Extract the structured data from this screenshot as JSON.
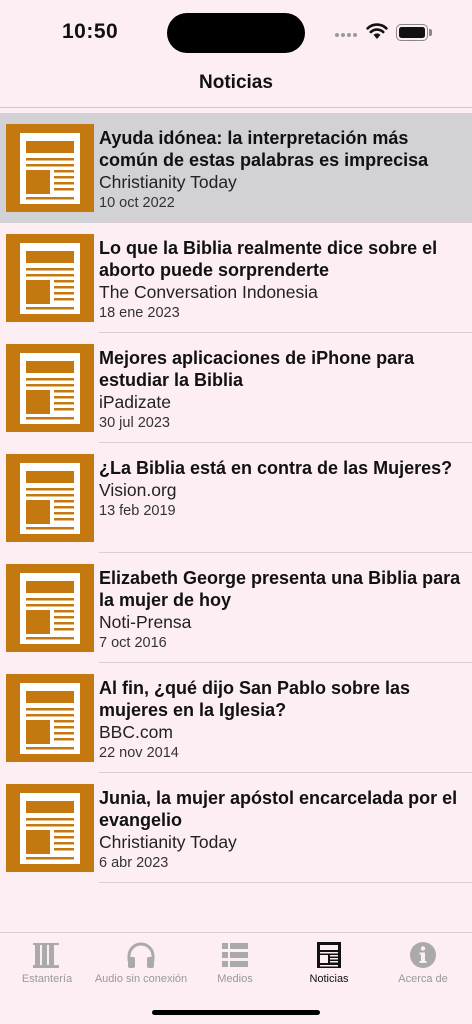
{
  "status_bar": {
    "time": "10:50"
  },
  "nav": {
    "title": "Noticias"
  },
  "news": [
    {
      "headline": "Ayuda idónea: la interpretación más común de estas palabras es imprecisa",
      "source": "Christianity Today",
      "date": "10 oct 2022",
      "selected": true
    },
    {
      "headline": "Lo que la Biblia realmente dice sobre el aborto puede sorprenderte",
      "source": "The Conversation Indonesia",
      "date": "18 ene 2023"
    },
    {
      "headline": "Mejores aplicaciones de iPhone para estudiar la Biblia",
      "source": "iPadizate",
      "date": "30 jul 2023"
    },
    {
      "headline": "¿La Biblia está en contra de las Mujeres?",
      "source": "Vision.org",
      "date": "13 feb 2019"
    },
    {
      "headline": "Elizabeth George presenta una Biblia para la mujer de hoy",
      "source": "Noti-Prensa",
      "date": "7 oct 2016"
    },
    {
      "headline": "Al fin, ¿qué dijo San Pablo sobre las mujeres en la Iglesia?",
      "source": "BBC.com",
      "date": "22 nov 2014"
    },
    {
      "headline": "Junia, la mujer apóstol encarcelada por el evangelio",
      "source": "Christianity Today",
      "date": "6 abr 2023"
    }
  ],
  "tab_bar": {
    "tabs": [
      {
        "label": "Estantería",
        "icon": "books-icon"
      },
      {
        "label": "Audio sin conexión",
        "icon": "headphones-icon"
      },
      {
        "label": "Medios",
        "icon": "list-icon"
      },
      {
        "label": "Noticias",
        "icon": "newspaper-icon",
        "active": true
      },
      {
        "label": "Acerca de",
        "icon": "info-icon"
      }
    ]
  },
  "colors": {
    "background": "#fdeef3",
    "accent": "#c37810",
    "selected_row": "#d1d1d6",
    "inactive_tab": "#999999"
  }
}
